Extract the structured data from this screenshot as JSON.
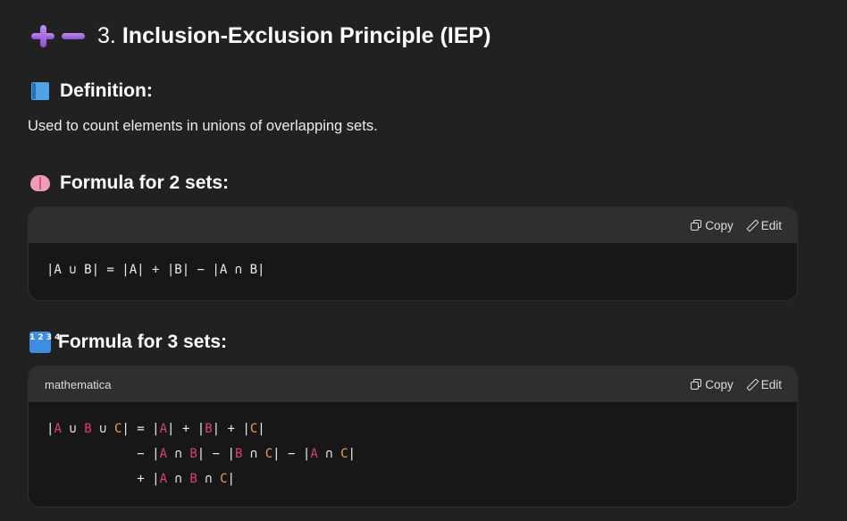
{
  "heading": {
    "number": "3.",
    "title": "Inclusion-Exclusion Principle (IEP)",
    "icons": [
      "plus-icon",
      "minus-icon"
    ]
  },
  "definition": {
    "icon": "book-icon",
    "heading": "Definition:",
    "text": "Used to count elements in unions of overlapping sets."
  },
  "formula2": {
    "icon": "brain-icon",
    "heading": "Formula for 2 sets:",
    "language": "",
    "copy_label": "Copy",
    "edit_label": "Edit",
    "lines": [
      "|A ∪ B| = |A| + |B| − |A ∩ B|"
    ]
  },
  "formula3": {
    "icon": "input-numbers-icon",
    "icon_text": "1 2 3 4",
    "heading": "Formula for 3 sets:",
    "language": "mathematica",
    "copy_label": "Copy",
    "edit_label": "Edit",
    "lines": [
      "|A ∪ B ∪ C| = |A| + |B| + |C|",
      "            − |A ∩ B| − |B ∩ C| − |A ∩ C|",
      "            + |A ∩ B ∩ C|"
    ]
  },
  "colors": {
    "background": "#212121",
    "code_background": "#171717",
    "code_header": "#2f2f2f",
    "highlight_pink": "#e23b7a",
    "highlight_orange": "#e8a34b"
  }
}
